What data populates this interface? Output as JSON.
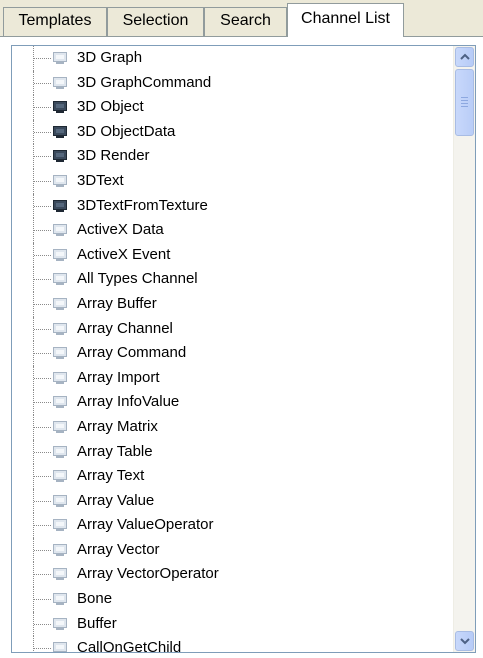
{
  "tabs": [
    {
      "label": "Templates",
      "active": false
    },
    {
      "label": "Selection",
      "active": false
    },
    {
      "label": "Search",
      "active": false
    },
    {
      "label": "Channel List",
      "active": true
    }
  ],
  "tree": {
    "items": [
      {
        "label": "3D Graph",
        "icon": "channel-icon-light"
      },
      {
        "label": "3D GraphCommand",
        "icon": "channel-icon-light"
      },
      {
        "label": "3D Object",
        "icon": "channel-icon-dark"
      },
      {
        "label": "3D ObjectData",
        "icon": "channel-icon-dark"
      },
      {
        "label": "3D Render",
        "icon": "channel-icon-dark"
      },
      {
        "label": "3DText",
        "icon": "channel-icon-light"
      },
      {
        "label": "3DTextFromTexture",
        "icon": "channel-icon-dark"
      },
      {
        "label": "ActiveX Data",
        "icon": "channel-icon-light"
      },
      {
        "label": "ActiveX Event",
        "icon": "channel-icon-light"
      },
      {
        "label": "All Types Channel",
        "icon": "channel-icon-light"
      },
      {
        "label": "Array Buffer",
        "icon": "channel-icon-light"
      },
      {
        "label": "Array Channel",
        "icon": "channel-icon-light"
      },
      {
        "label": "Array Command",
        "icon": "channel-icon-light"
      },
      {
        "label": "Array Import",
        "icon": "channel-icon-light"
      },
      {
        "label": "Array InfoValue",
        "icon": "channel-icon-light"
      },
      {
        "label": "Array Matrix",
        "icon": "channel-icon-light"
      },
      {
        "label": "Array Table",
        "icon": "channel-icon-light"
      },
      {
        "label": "Array Text",
        "icon": "channel-icon-light"
      },
      {
        "label": "Array Value",
        "icon": "channel-icon-light"
      },
      {
        "label": "Array ValueOperator",
        "icon": "channel-icon-light"
      },
      {
        "label": "Array Vector",
        "icon": "channel-icon-light"
      },
      {
        "label": "Array VectorOperator",
        "icon": "channel-icon-light"
      },
      {
        "label": "Bone",
        "icon": "channel-icon-light"
      },
      {
        "label": "Buffer",
        "icon": "channel-icon-light"
      },
      {
        "label": "CallOnGetChild",
        "icon": "channel-icon-light"
      }
    ]
  },
  "scrollbar": {
    "position": 0.0,
    "visible_fraction": 0.12
  },
  "colors": {
    "icon_light_fill": "#dfe6ee",
    "icon_light_stroke": "#a6b3c2",
    "icon_dark_fill": "#3b4a5c",
    "icon_dark_stroke": "#1e2833"
  }
}
